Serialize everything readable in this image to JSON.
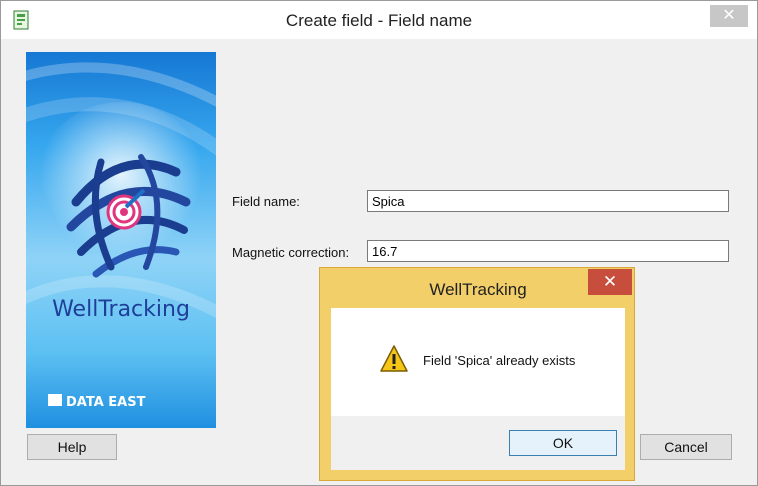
{
  "window": {
    "title": "Create field - Field name",
    "close_glyph": "✕",
    "icon": "app-icon"
  },
  "banner": {
    "brand": "WellTracking",
    "maker": "DATA EAST"
  },
  "form": {
    "field_name_label": "Field name:",
    "field_name_value": "Spica",
    "magnetic_label": "Magnetic correction:",
    "magnetic_value": "16.7"
  },
  "buttons": {
    "help": "Help",
    "cancel": "Cancel"
  },
  "dialog": {
    "title": "WellTracking",
    "close_glyph": "✕",
    "message": "Field 'Spica' already exists",
    "ok": "OK",
    "icon": "warning-icon"
  },
  "colors": {
    "dialog_frame": "#f3cf6a",
    "dialog_close": "#c74e3d",
    "banner_blue": "#2f9fe6"
  }
}
